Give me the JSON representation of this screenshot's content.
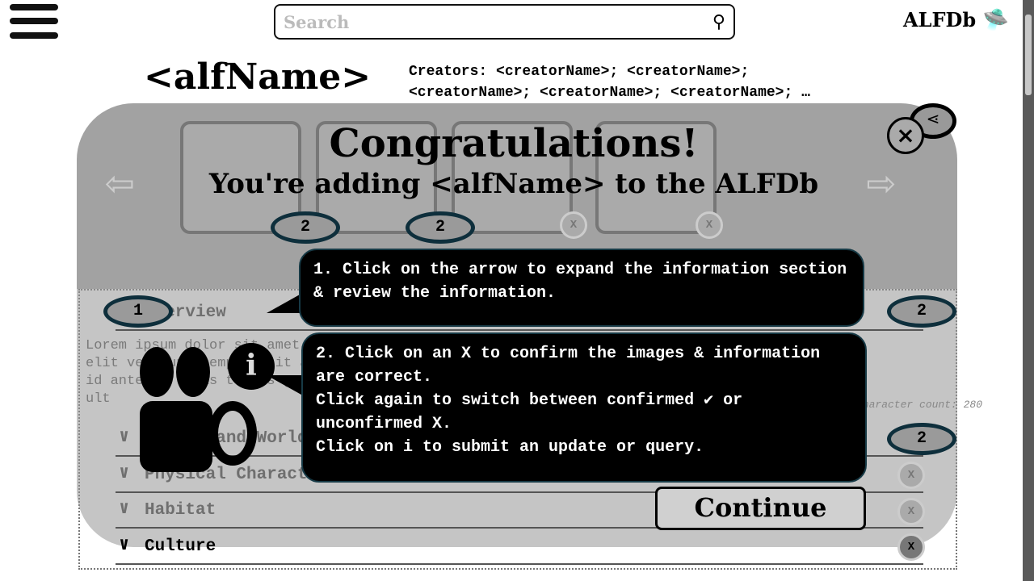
{
  "header": {
    "search_placeholder": "Search",
    "logo": "ALFDb"
  },
  "page": {
    "alf_name": "<alfName>",
    "creators_line1": "Creators: <creatorName>; <creatorName>;",
    "creators_line2": "<creatorName>; <creatorName>; <creatorName>; …"
  },
  "sections": [
    {
      "label": "Overview"
    },
    {
      "label": "Origin and World"
    },
    {
      "label": "Physical Characteristics"
    },
    {
      "label": "Habitat"
    },
    {
      "label": "Culture"
    }
  ],
  "lorem": [
    "Lorem ipsum dolor sit amet, consectetur adipiscing elit. Curabitur pharetra",
    "elit vel nunc tempor, sit amet porta nisl posuere. Nunc",
    "id ante in felis tempus gravida, sed luctus et",
    "ult"
  ],
  "char_count": "character count: 280",
  "modal": {
    "title": "Congratulations!",
    "subtitle": "You're adding <alfName> to the ALFDb",
    "step1": "1. Click on the arrow to expand the information section & review the information.",
    "step2a": "2. Click on an X to confirm the images & information are correct.",
    "step2b": "Click again to switch between confirmed ✔ or unconfirmed X.",
    "step2c": "Click on i to submit an update or query.",
    "continue": "Continue",
    "badge_thumbs": [
      "2",
      "2"
    ],
    "badge_overview_left": "1",
    "badge_overview_right": "2",
    "badge_origin": "2",
    "x": "X",
    "info": "i"
  }
}
